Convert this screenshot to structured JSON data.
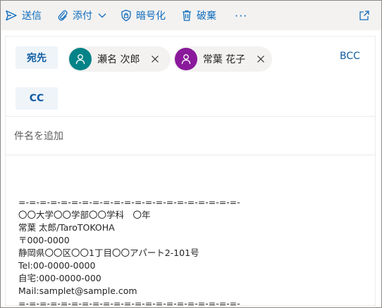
{
  "toolbar": {
    "send_label": "送信",
    "attach_label": "添付",
    "encrypt_label": "暗号化",
    "discard_label": "破棄",
    "more_label": "···"
  },
  "recipients": {
    "to_label": "宛先",
    "cc_label": "CC",
    "bcc_label": "BCC",
    "to": [
      {
        "name": "瀬名 次郎",
        "avatar_color": "#038387"
      },
      {
        "name": "常葉 花子",
        "avatar_color": "#8a1a9b"
      }
    ]
  },
  "subject": {
    "placeholder": "件名を追加",
    "value": ""
  },
  "signature": {
    "lines": [
      "=-=-=-=-=-=-=-=-=-=-=-=-=-=-=-=-=-=-=-=-=-",
      "〇〇大学〇〇学部〇〇学科　〇年",
      "常葉 太郎/TaroTOKOHA",
      "〒000-0000",
      "静岡県〇〇区〇〇1丁目〇〇アパート2-101号",
      "Tel:00-0000-0000",
      "自宅:000-0000-000",
      "Mail:samplet@sample.com",
      "=-=-=-=-=-=-=-=-=-=-=-=-=-=-=-=-=-=-=-=-=-"
    ]
  },
  "colors": {
    "accent": "#0f6cbd",
    "toolbar_bg": "#f3f2f1",
    "field_button_bg": "#eff4f9"
  }
}
